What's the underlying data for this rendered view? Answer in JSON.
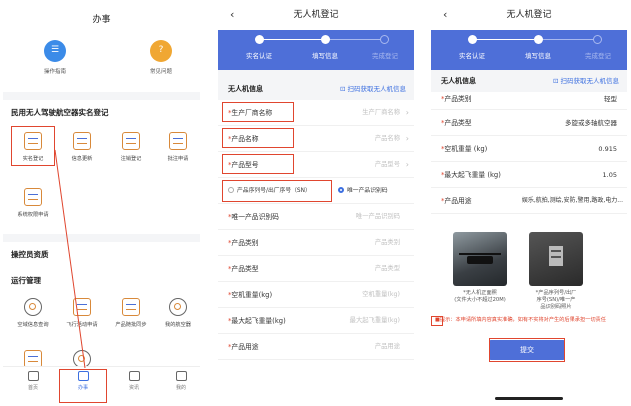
{
  "panel1": {
    "title": "办事",
    "top_tiles": [
      {
        "label": "操作指南",
        "icon": "guide-icon",
        "color": "#3b8be8"
      },
      {
        "label": "常见问题",
        "icon": "question-icon",
        "color": "#f0a733"
      }
    ],
    "section_reg": "民用无人驾驶航空器实名登记",
    "reg_items": [
      {
        "label": "实名登记",
        "icon": "real-name-register-icon"
      },
      {
        "label": "信息更新",
        "icon": "info-update-icon"
      },
      {
        "label": "注销登记",
        "icon": "deregister-icon"
      },
      {
        "label": "批注申请",
        "icon": "annotation-apply-icon"
      },
      {
        "label": "系统权限申请",
        "icon": "permission-apply-icon"
      }
    ],
    "section_operator": "操控员资质",
    "section_ops": "运行管理",
    "ops_items": [
      {
        "label": "空域信息查询",
        "icon": "airspace-query-icon"
      },
      {
        "label": "飞行活动申请",
        "icon": "flight-apply-icon"
      },
      {
        "label": "产品随批同步",
        "icon": "product-sync-icon"
      },
      {
        "label": "我的航空器",
        "icon": "my-aircraft-icon"
      },
      {
        "label": "",
        "icon": "report-icon"
      },
      {
        "label": "",
        "icon": "search-record-icon"
      }
    ],
    "tabs": [
      {
        "label": "首页",
        "icon": "home-icon",
        "active": false
      },
      {
        "label": "办事",
        "icon": "task-icon",
        "active": true
      },
      {
        "label": "资讯",
        "icon": "news-icon",
        "active": false
      },
      {
        "label": "我的",
        "icon": "profile-icon",
        "active": false
      }
    ]
  },
  "panel2": {
    "title": "无人机登记",
    "steps": [
      "实名认证",
      "填写信息",
      "完成登记"
    ],
    "info_header": "无人机信息",
    "scan_link": "扫码获取无人机信息",
    "fields": [
      {
        "label": "生产厂商名称",
        "placeholder": "生产厂商名称"
      },
      {
        "label": "产品名称",
        "placeholder": "产品名称"
      },
      {
        "label": "产品型号",
        "placeholder": "产品型号"
      }
    ],
    "radio_options": [
      "产品序列号/出厂序号（SN）",
      "唯一产品识别码"
    ],
    "fields2": [
      {
        "label": "唯一产品识别码",
        "placeholder": "唯一产品识别码"
      },
      {
        "label": "产品类别",
        "placeholder": "产品类别"
      },
      {
        "label": "产品类型",
        "placeholder": "产品类型"
      },
      {
        "label": "空机重量(kg)",
        "placeholder": "空机重量(kg)"
      },
      {
        "label": "最大起飞重量(kg)",
        "placeholder": "最大起飞重量(kg)"
      },
      {
        "label": "产品用途",
        "placeholder": "产品用途"
      }
    ]
  },
  "panel3": {
    "title": "无人机登记",
    "steps": [
      "实名认证",
      "填写信息",
      "完成登记"
    ],
    "info_header": "无人机信息",
    "scan_link": "扫码获取无人机信息",
    "rows": [
      {
        "label": "产品类别",
        "value": "轻型"
      },
      {
        "label": "产品类型",
        "value": "多旋或多轴航空器"
      },
      {
        "label": "空机重量 (kg)",
        "value": "0.915"
      },
      {
        "label": "最大起飞重量 (kg)",
        "value": "1.05"
      },
      {
        "label": "产品用途",
        "value": "娱乐,航拍,测绘,安防,警用,路政,电力..."
      }
    ],
    "photo1_caption": "*无人机正面照\n(文件大小不超过20M)",
    "photo2_caption": "*产品序列号/出厂\n序号(SN)/唯一产\n品识别码照片",
    "notice": "■提示：本申请所填内容真实准确，如有不实将对产生的后果承担一切责任",
    "submit": "提交"
  }
}
